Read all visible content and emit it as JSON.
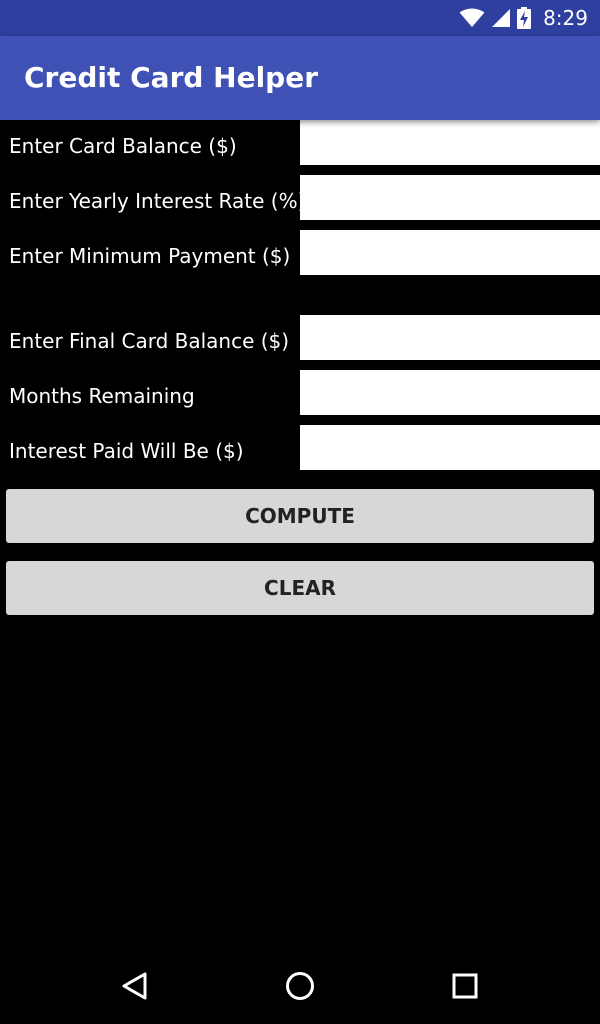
{
  "status_bar": {
    "time": "8:29",
    "icons": [
      "wifi-icon",
      "cell-signal-icon",
      "battery-charging-icon"
    ]
  },
  "app_bar": {
    "title": "Credit Card Helper"
  },
  "form": {
    "card_balance_label": "Enter Card Balance ($)",
    "card_balance_value": "",
    "interest_rate_label": "Enter Yearly Interest Rate (%)",
    "interest_rate_value": "",
    "min_payment_label": "Enter Minimum Payment ($)",
    "min_payment_value": "",
    "final_balance_label": "Enter Final Card Balance ($)",
    "final_balance_value": "",
    "months_remaining_label": "Months Remaining",
    "months_remaining_value": "",
    "interest_paid_label": "Interest Paid Will Be ($)",
    "interest_paid_value": ""
  },
  "buttons": {
    "compute": "COMPUTE",
    "clear": "CLEAR"
  },
  "nav_bar": {
    "icons": [
      "back-icon",
      "home-icon",
      "recents-icon"
    ]
  },
  "colors": {
    "status_bar": "#2f3fa0",
    "app_bar": "#3f51b5",
    "background": "#000000",
    "field": "#ffffff",
    "button": "#d6d7d7"
  }
}
